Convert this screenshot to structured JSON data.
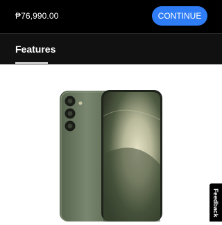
{
  "checkout_bar": {
    "price": "₱76,990.00",
    "continue_label": "CONTINUE"
  },
  "tabs": [
    {
      "label": "Features",
      "selected": true
    }
  ],
  "product_image": {
    "description_icon": "phone-product-image",
    "body_color": "#6e7a62"
  },
  "feedback": {
    "label": "Feedback"
  },
  "colors": {
    "accent": "#2f7df6",
    "topbar_bg": "#000000",
    "tabbar_bg": "#111111"
  }
}
